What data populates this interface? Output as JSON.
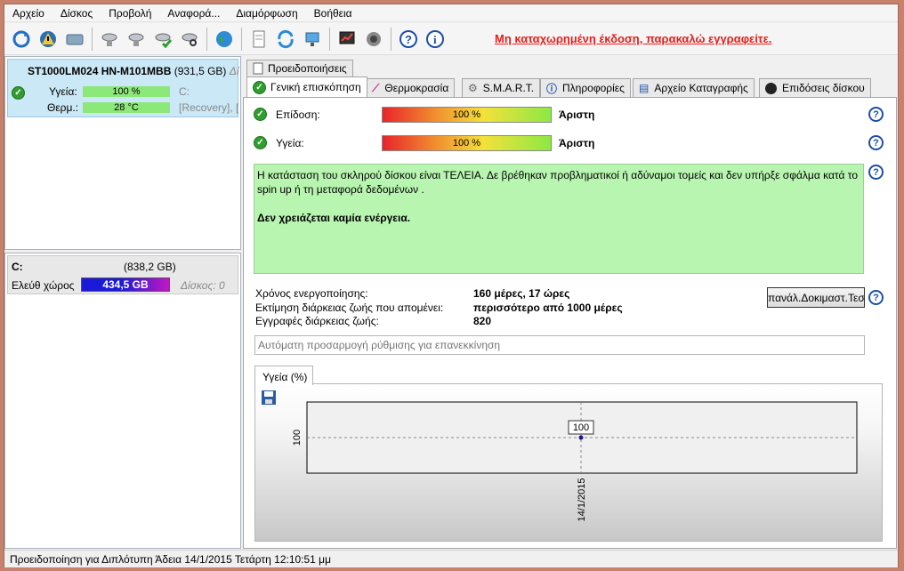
{
  "menu": [
    "Αρχείο",
    "Δίσκος",
    "Προβολή",
    "Αναφορά...",
    "Διαμόρφωση",
    "Βοήθεια"
  ],
  "toolbar": {
    "register_text": "Μη καταχωρημένη έκδοση, παρακαλώ εγγραφείτε."
  },
  "disk": {
    "name": "ST1000LM024 HN-M101MBB",
    "size": "(931,5 GB)",
    "extra": "Δί",
    "health_label": "Υγεία:",
    "health_value": "100 %",
    "drive": "C:",
    "temp_label": "Θερμ.:",
    "temp_value": "28 °C",
    "recovery": "[Recovery],  ["
  },
  "partition": {
    "name": "C:",
    "size": "(838,2 GB)",
    "free_label": "Ελεύθ χώρος",
    "free_value": "434,5 GB",
    "disk_label": "Δίσκος: 0"
  },
  "tabs": {
    "warnings": "Προειδοποιήσεις",
    "overview": "Γενική επισκόπηση",
    "temperature": "Θερμοκρασία",
    "smart": "S.M.A.R.T.",
    "info": "Πληροφορίες",
    "log": "Αρχείο Καταγραφής",
    "performance": "Επιδόσεις δίσκου"
  },
  "overview": {
    "perf_label": "Επίδοση:",
    "perf_value": "100 %",
    "perf_rating": "Άριστη",
    "health_label": "Υγεία:",
    "health_value": "100 %",
    "health_rating": "Άριστη",
    "message": "Η κατάσταση του σκληρού δίσκου είναι ΤΕΛΕΙΑ. Δε βρέθηκαν προβληματικοί ή αδύναμοι τομείς και δεν υπήρξε σφάλμα κατά το spin up ή τη μεταφορά δεδομένων .",
    "action": "Δεν χρειάζεται καμία ενέργεια.",
    "uptime_label": "Χρόνος ενεργοποίησης:",
    "uptime_value": "160 μέρες, 17 ώρες",
    "remaining_label": "Εκτίμηση διάρκειας ζωής που απομένει:",
    "remaining_value": "περισσότερο από 1000 μέρες",
    "records_label": "Εγγραφές διάρκειας ζωής:",
    "records_value": "820",
    "retest_button": "πανάλ.Δοκιμαστ.Τεσ",
    "auto_adjust_placeholder": "Αυτόματη προσαρμογή ρύθμισης για επανεκκίνηση",
    "chart_tab": "Υγεία (%)"
  },
  "status_text": "Προειδοποίηση για Διπλότυπη  Άδεια 14/1/2015 Τετάρτη 12:10:51 μμ",
  "chart_data": {
    "type": "line",
    "x": [
      "14/1/2015"
    ],
    "series": [
      {
        "values": [
          100
        ]
      }
    ],
    "ylabel": "",
    "xlabel": "",
    "data_labels": [
      "100"
    ],
    "y_tick": "100",
    "x_tick": "14/1/2015"
  }
}
